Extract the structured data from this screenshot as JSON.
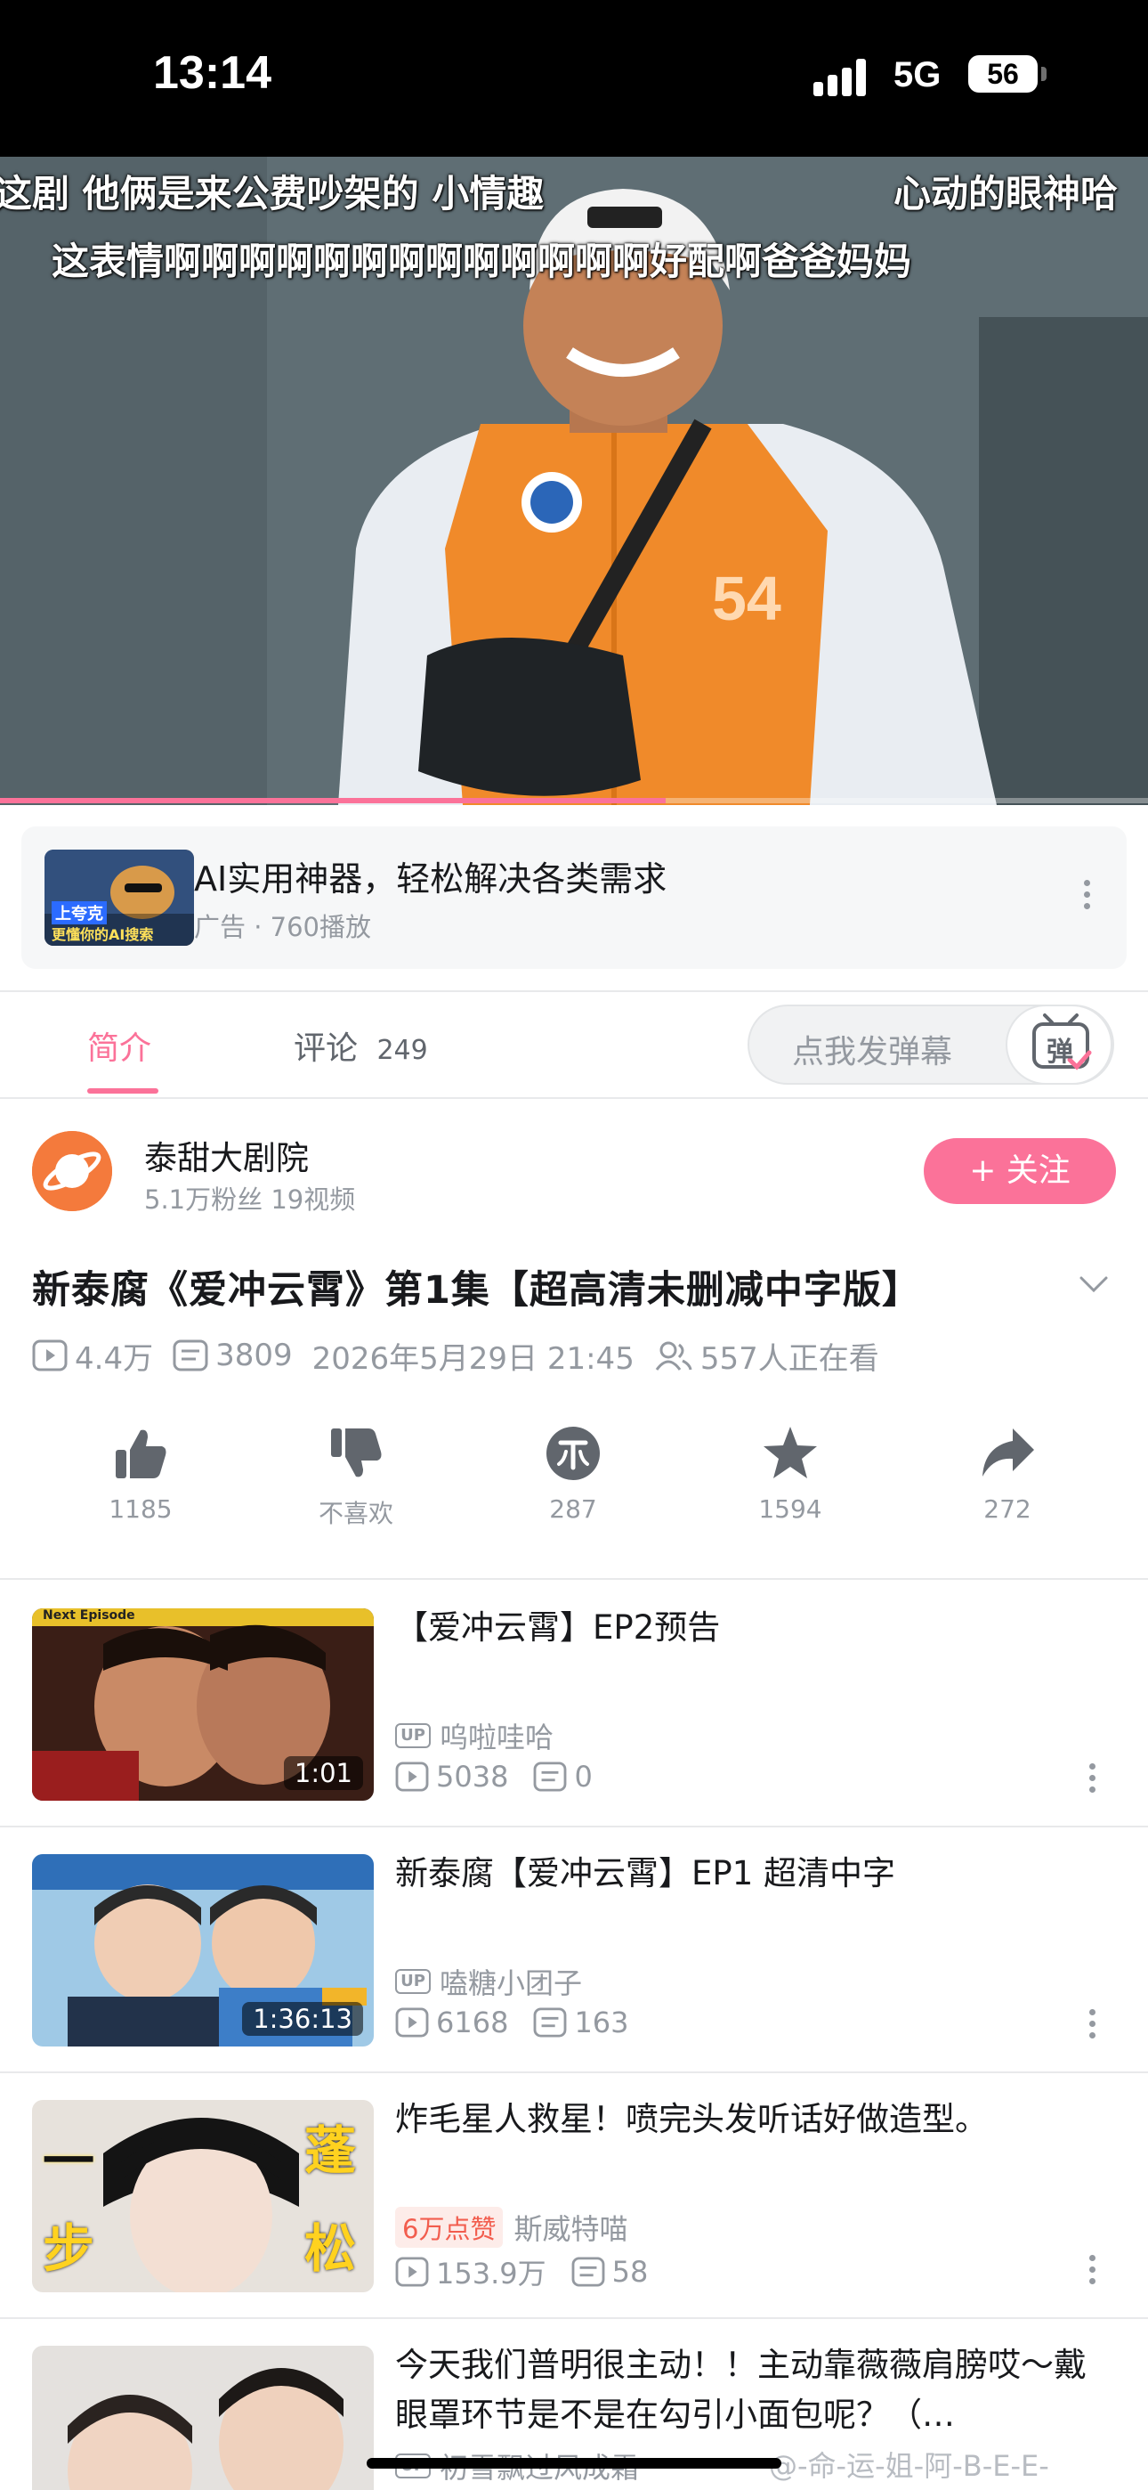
{
  "status_bar": {
    "time": "13:14",
    "network": "5G",
    "battery": "56"
  },
  "player": {
    "danmaku": [
      "这剧 他俩是来公费吵架的 小情趣",
      "心动的眼神哈",
      "这表情啊啊啊啊啊啊啊啊啊啊啊啊啊好配啊爸爸妈妈"
    ],
    "progress": 0.58
  },
  "ad": {
    "thumb_caption_1": "上夸克",
    "thumb_caption_2": "更懂你的AI搜索",
    "title": "AI实用神器，轻松解决各类需求",
    "meta": "广告 · 760播放"
  },
  "tabs": [
    {
      "label": "简介"
    },
    {
      "label": "评论",
      "count": "249"
    }
  ],
  "danmaku_input": {
    "placeholder": "点我发弹幕",
    "button": "弹"
  },
  "uploader": {
    "name": "泰甜大剧院",
    "meta": "5.1万粉丝  19视频",
    "follow_label": "+ 关注"
  },
  "video": {
    "title": "新泰腐《爱冲云霄》第1集【超高清未删减中字版】",
    "views": "4.4万",
    "danmaku_count": "3809",
    "date": "2026年5月29日 21:45",
    "watching": "557人正在看"
  },
  "actions": [
    {
      "icon": "thumbs-up-icon",
      "label": "1185"
    },
    {
      "icon": "thumbs-down-icon",
      "label": "不喜欢"
    },
    {
      "icon": "coin-icon",
      "label": "287"
    },
    {
      "icon": "star-icon",
      "label": "1594"
    },
    {
      "icon": "share-icon",
      "label": "272"
    }
  ],
  "recommendations": [
    {
      "title": "【爱冲云霄】EP2预告",
      "author": "呜啦哇哈",
      "badge": "UP",
      "views": "5038",
      "danmaku": "0",
      "duration": "1:01",
      "thumb_tag": "Next Episode"
    },
    {
      "title": "新泰腐【爱冲云霄】EP1  超清中字",
      "author": "嗑糖小团子",
      "badge": "UP",
      "views": "6168",
      "danmaku": "163",
      "duration": "1:36:13"
    },
    {
      "title": "炸毛星人救星！喷完头发听话好做造型。",
      "author": "斯威特喵",
      "likes": "6万点赞",
      "views": "153.9万",
      "danmaku": "58",
      "thumb_text_1": "一",
      "thumb_text_2": "蓬",
      "thumb_text_3": "步",
      "thumb_text_4": "松"
    },
    {
      "title": "今天我们普明很主动！！主动靠薇薇肩膀哎～戴眼罩环节是不是在勾引小面包呢？（…",
      "author": "初雪飘过风成霜"
    }
  ],
  "watermark": "@-命-运-姐-阿-B-E-E-",
  "colors": {
    "accent": "#fb7299",
    "muted": "#9499a0",
    "vest": "#f08a2a"
  }
}
